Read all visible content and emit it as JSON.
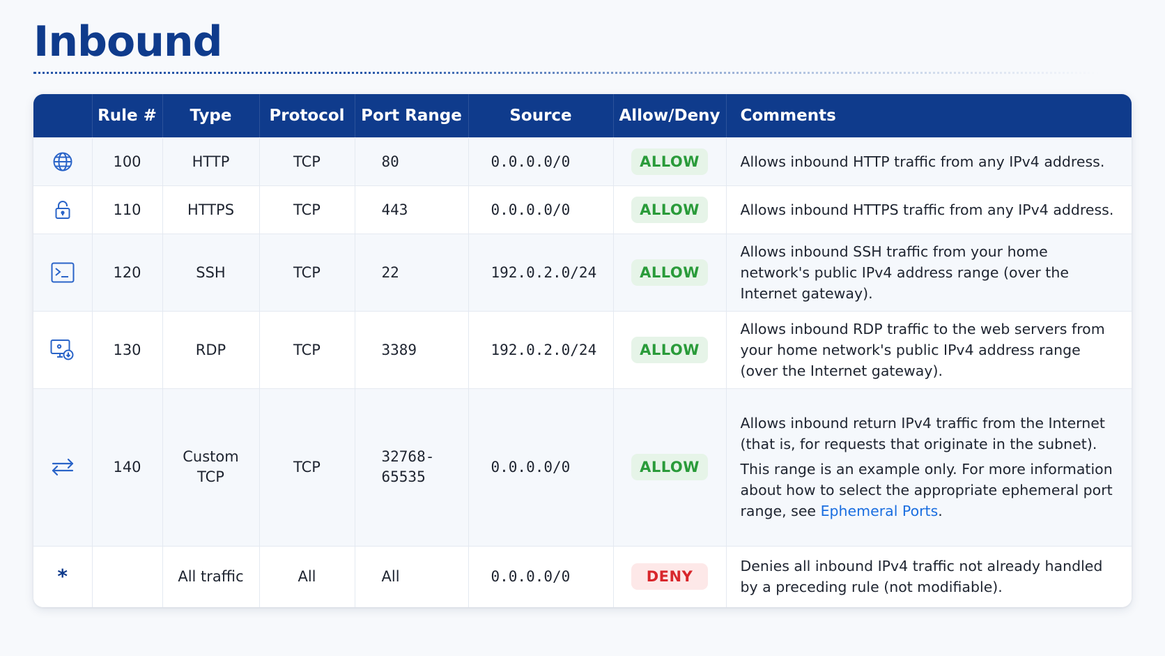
{
  "page": {
    "title": "Inbound"
  },
  "colors": {
    "title": "#0f3b8c",
    "header_bg": "#0f3b8c",
    "allow_text": "#2a9b3a",
    "allow_bg": "#e6f4e8",
    "deny_text": "#d8262b",
    "deny_bg": "#fde8e8",
    "link": "#1a6ee0"
  },
  "table": {
    "headers": [
      "",
      "Rule #",
      "Type",
      "Protocol",
      "Port Range",
      "Source",
      "Allow/Deny",
      "Comments"
    ],
    "rows": [
      {
        "icon": "globe-icon",
        "rule": "100",
        "type_line1": "HTTP",
        "type_line2": "",
        "protocol": "TCP",
        "port_line1": "80",
        "port_line2": "",
        "source": "0.0.0.0/0",
        "action": "ALLOW",
        "comment_1": "Allows inbound HTTP traffic from any IPv4 address."
      },
      {
        "icon": "lock-icon",
        "rule": "110",
        "type_line1": "HTTPS",
        "type_line2": "",
        "protocol": "TCP",
        "port_line1": "443",
        "port_line2": "",
        "source": "0.0.0.0/0",
        "action": "ALLOW",
        "comment_1": "Allows inbound HTTPS traffic from any IPv4 address."
      },
      {
        "icon": "terminal-icon",
        "rule": "120",
        "type_line1": "SSH",
        "type_line2": "",
        "protocol": "TCP",
        "port_line1": "22",
        "port_line2": "",
        "source": "192.0.2.0/24",
        "action": "ALLOW",
        "comment_1": "Allows inbound SSH traffic from your home network's public IPv4 address range (over the Internet gateway)."
      },
      {
        "icon": "remote-desktop-icon",
        "rule": "130",
        "type_line1": "RDP",
        "type_line2": "",
        "protocol": "TCP",
        "port_line1": "3389",
        "port_line2": "",
        "source": "192.0.2.0/24",
        "action": "ALLOW",
        "comment_1": "Allows inbound RDP traffic to the web servers from your home network's public IPv4 address range (over the Internet gateway)."
      },
      {
        "icon": "bidirectional-arrows-icon",
        "rule": "140",
        "type_line1": "Custom",
        "type_line2": "TCP",
        "protocol": "TCP",
        "port_line1": "32768-",
        "port_line2": "65535",
        "source": "0.0.0.0/0",
        "action": "ALLOW",
        "comment_1": "Allows inbound return IPv4 traffic from the Internet (that is, for requests that originate in the subnet).",
        "comment_2": "This range is an example only. For more information about how to select the appropriate ephemeral port range, see",
        "comment_link": "Ephemeral Ports",
        "comment_end": "."
      },
      {
        "icon": "asterisk-icon",
        "icon_text": "*",
        "rule": "",
        "type_line1": "All traffic",
        "type_line2": "",
        "protocol": "All",
        "port_line1": "All",
        "port_line2": "",
        "source": "0.0.0.0/0",
        "action": "DENY",
        "comment_1": "Denies all inbound IPv4 traffic not already handled by a preceding rule (not modifiable)."
      }
    ]
  }
}
